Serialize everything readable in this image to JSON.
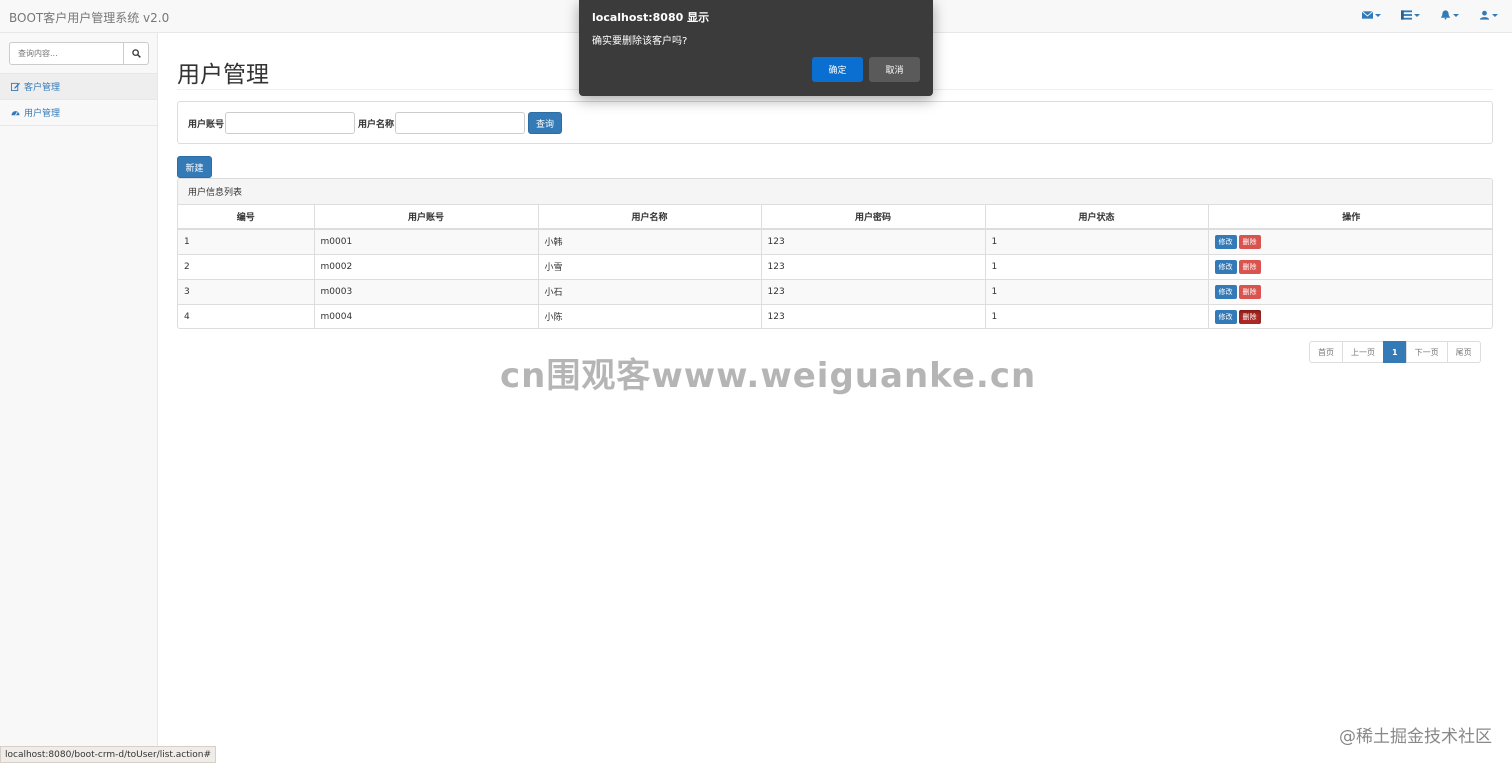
{
  "app": {
    "brand": "BOOT客户用户管理系统 v2.0"
  },
  "colors": {
    "primary": "#337ab7",
    "danger": "#d9534f",
    "dialog_bg": "#3b3b3b"
  },
  "nav": {
    "icons": [
      "envelope-icon",
      "tasks-icon",
      "bell-icon",
      "user-icon"
    ]
  },
  "sidebar": {
    "search_placeholder": "查询内容...",
    "items": [
      {
        "label": "客户管理",
        "icon": "edit-icon"
      },
      {
        "label": "用户管理",
        "icon": "dashboard-icon"
      }
    ]
  },
  "main": {
    "title": "用户管理",
    "filters": {
      "account_label": "用户账号",
      "name_label": "用户名称",
      "query_label": "查询"
    },
    "new_label": "新建",
    "list_heading": "用户信息列表",
    "columns": [
      "编号",
      "用户账号",
      "用户名称",
      "用户密码",
      "用户状态",
      "操作"
    ],
    "rows": [
      {
        "id": "1",
        "account": "m0001",
        "name": "小韩",
        "password": "123",
        "status": "1"
      },
      {
        "id": "2",
        "account": "m0002",
        "name": "小雪",
        "password": "123",
        "status": "1"
      },
      {
        "id": "3",
        "account": "m0003",
        "name": "小石",
        "password": "123",
        "status": "1"
      },
      {
        "id": "4",
        "account": "m0004",
        "name": "小陈",
        "password": "123",
        "status": "1"
      }
    ],
    "edit_label": "修改",
    "delete_label": "删除",
    "pagination": [
      "首页",
      "上一页",
      "1",
      "下一页",
      "尾页"
    ]
  },
  "dialog": {
    "title": "localhost:8080 显示",
    "message": "确实要删除该客户吗?",
    "ok": "确定",
    "cancel": "取消"
  },
  "watermark": "cn围观客www.weiguanke.cn",
  "corner_watermark": "@稀土掘金技术社区",
  "status_url": "localhost:8080/boot-crm-d/toUser/list.action#"
}
